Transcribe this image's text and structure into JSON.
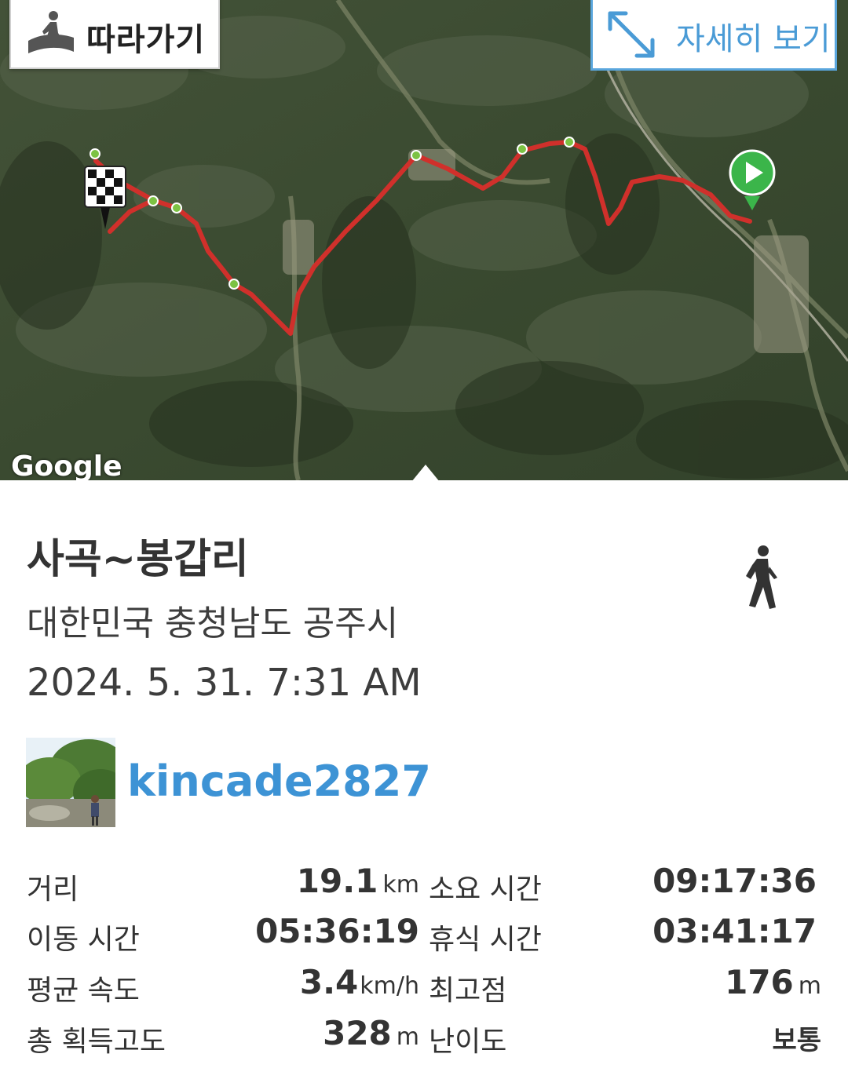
{
  "map": {
    "follow_label": "따라가기",
    "detail_label": "자세히 보기",
    "google_logo": "Google",
    "colors": {
      "route": "#d0302b",
      "waypoint": "#7cc243",
      "start": "#3bb54a"
    }
  },
  "track": {
    "title": "사곡~봉갑리",
    "location": "대한민국 충청남도 공주시",
    "datetime": "2024. 5. 31. 7:31 AM",
    "username": "kincade2827",
    "activity_icon": "walking-person-icon"
  },
  "stats": {
    "distance_label": "거리",
    "distance_value": "19.1",
    "distance_unit": "km",
    "total_time_label": "소요 시간",
    "total_time_value": "09:17:36",
    "moving_time_label": "이동 시간",
    "moving_time_value": "05:36:19",
    "rest_time_label": "휴식 시간",
    "rest_time_value": "03:41:17",
    "avg_speed_label": "평균 속도",
    "avg_speed_value": "3.4",
    "avg_speed_unit": "km/h",
    "max_alt_label": "최고점",
    "max_alt_value": "176",
    "max_alt_unit": "m",
    "elev_gain_label": "총 획득고도",
    "elev_gain_value": "328",
    "elev_gain_unit": "m",
    "difficulty_label": "난이도",
    "difficulty_value": "보통"
  }
}
